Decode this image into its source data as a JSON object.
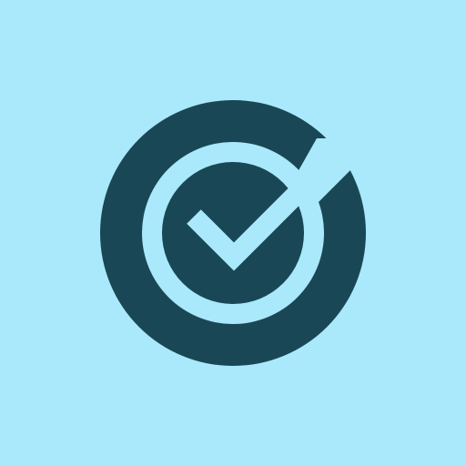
{
  "app": {
    "title": ""
  },
  "icon": {
    "name": "check-circle-icon",
    "colors": {
      "background": "#A9E9FB",
      "foreground": "#1A4756"
    }
  }
}
